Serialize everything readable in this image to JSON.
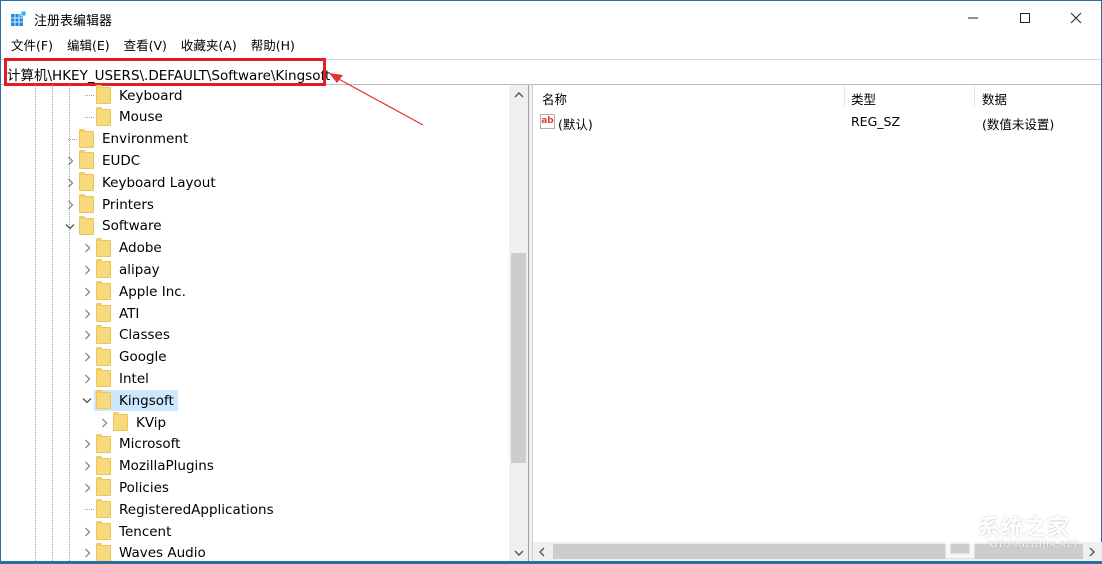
{
  "window": {
    "title": "注册表编辑器",
    "icon": "registry-editor-icon",
    "controls": {
      "minimize": "—",
      "maximize": "☐",
      "close": "✕"
    }
  },
  "menu": [
    {
      "label": "文件(F)"
    },
    {
      "label": "编辑(E)"
    },
    {
      "label": "查看(V)"
    },
    {
      "label": "收藏夹(A)"
    },
    {
      "label": "帮助(H)"
    }
  ],
  "address": {
    "path": "计算机\\HKEY_USERS\\.DEFAULT\\Software\\Kingsoft"
  },
  "annotation": {
    "color": "#e02020"
  },
  "tree": {
    "items": [
      {
        "label": "Keyboard",
        "level": 4,
        "expander": "none"
      },
      {
        "label": "Mouse",
        "level": 4,
        "expander": "none"
      },
      {
        "label": "Environment",
        "level": 3,
        "expander": "none"
      },
      {
        "label": "EUDC",
        "level": 3,
        "expander": "collapsed"
      },
      {
        "label": "Keyboard Layout",
        "level": 3,
        "expander": "collapsed"
      },
      {
        "label": "Printers",
        "level": 3,
        "expander": "collapsed"
      },
      {
        "label": "Software",
        "level": 3,
        "expander": "expanded"
      },
      {
        "label": "Adobe",
        "level": 4,
        "expander": "collapsed"
      },
      {
        "label": "alipay",
        "level": 4,
        "expander": "collapsed"
      },
      {
        "label": "Apple Inc.",
        "level": 4,
        "expander": "collapsed"
      },
      {
        "label": "ATI",
        "level": 4,
        "expander": "collapsed"
      },
      {
        "label": "Classes",
        "level": 4,
        "expander": "collapsed"
      },
      {
        "label": "Google",
        "level": 4,
        "expander": "collapsed"
      },
      {
        "label": "Intel",
        "level": 4,
        "expander": "collapsed"
      },
      {
        "label": "Kingsoft",
        "level": 4,
        "expander": "expanded",
        "selected": true
      },
      {
        "label": "KVip",
        "level": 5,
        "expander": "collapsed"
      },
      {
        "label": "Microsoft",
        "level": 4,
        "expander": "collapsed"
      },
      {
        "label": "MozillaPlugins",
        "level": 4,
        "expander": "collapsed"
      },
      {
        "label": "Policies",
        "level": 4,
        "expander": "collapsed"
      },
      {
        "label": "RegisteredApplications",
        "level": 4,
        "expander": "none"
      },
      {
        "label": "Tencent",
        "level": 4,
        "expander": "collapsed"
      },
      {
        "label": "Waves Audio",
        "level": 4,
        "expander": "collapsed"
      }
    ],
    "scroll": {
      "up": "^",
      "down": "v"
    }
  },
  "list": {
    "columns": [
      {
        "label": "名称"
      },
      {
        "label": "类型"
      },
      {
        "label": "数据"
      }
    ],
    "rows": [
      {
        "icon": "ab",
        "name": "(默认)",
        "type": "REG_SZ",
        "data": "(数值未设置)"
      }
    ],
    "scroll": {
      "left": "<",
      "right": ">"
    }
  },
  "watermark": {
    "text": "系统之家",
    "sub": "XITONGZHIJIA.NET"
  }
}
